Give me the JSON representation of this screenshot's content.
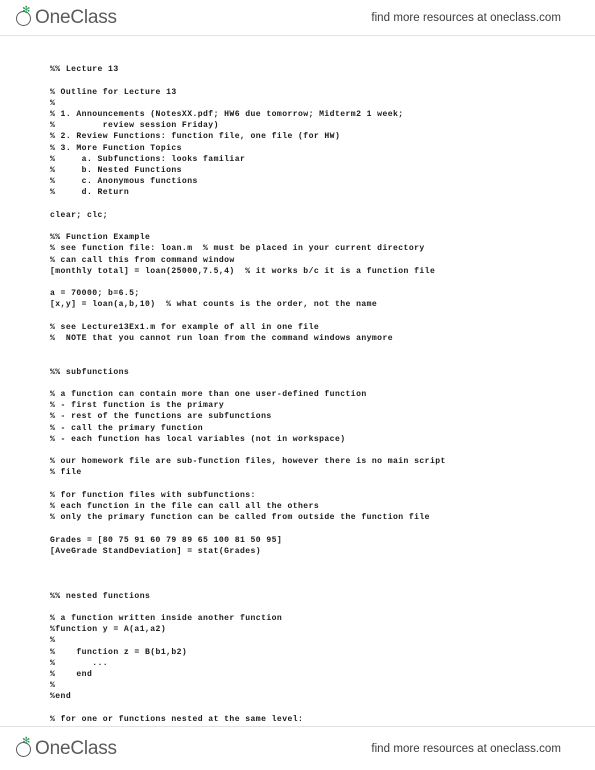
{
  "header": {
    "logo_text": "OneClass",
    "logo_mark": "sprout-leaf-icon",
    "promo_text": "find more resources at oneclass.com"
  },
  "footer": {
    "logo_text": "OneClass",
    "promo_text": "find more resources at oneclass.com"
  },
  "document": {
    "kind": "matlab-lecture-notes",
    "lines": [
      "%% Lecture 13",
      "",
      "% Outline for Lecture 13",
      "%",
      "% 1. Announcements (NotesXX.pdf; HW6 due tomorrow; Midterm2 1 week;",
      "%         review session Friday)",
      "% 2. Review Functions: function file, one file (for HW)",
      "% 3. More Function Topics",
      "%     a. Subfunctions: looks familiar",
      "%     b. Nested Functions",
      "%     c. Anonymous functions",
      "%     d. Return",
      "",
      "clear; clc;",
      "",
      "%% Function Example",
      "% see function file: loan.m  % must be placed in your current directory",
      "% can call this from command window",
      "[monthly total] = loan(25000,7.5,4)  % it works b/c it is a function file",
      "",
      "a = 70000; b=6.5;",
      "[x,y] = loan(a,b,10)  % what counts is the order, not the name",
      "",
      "% see Lecture13Ex1.m for example of all in one file",
      "%  NOTE that you cannot run loan from the command windows anymore",
      "",
      "",
      "%% subfunctions",
      "",
      "% a function can contain more than one user-defined function",
      "% - first function is the primary",
      "% - rest of the functions are subfunctions",
      "% - call the primary function",
      "% - each function has local variables (not in workspace)",
      "",
      "% our homework file are sub-function files, however there is no main script",
      "% file",
      "",
      "% for function files with subfunctions:",
      "% each function in the file can call all the others",
      "% only the primary function can be called from outside the function file",
      "",
      "Grades = [80 75 91 60 79 89 65 100 81 50 95]",
      "[AveGrade StandDeviation] = stat(Grades)",
      "",
      "",
      "",
      "%% nested functions",
      "",
      "% a function written inside another function",
      "%function y = A(a1,a2)",
      "%",
      "%    function z = B(b1,b2)",
      "%       ...",
      "%    end",
      "%",
      "%end",
      "",
      "% for one or functions nested at the same level:"
    ]
  }
}
